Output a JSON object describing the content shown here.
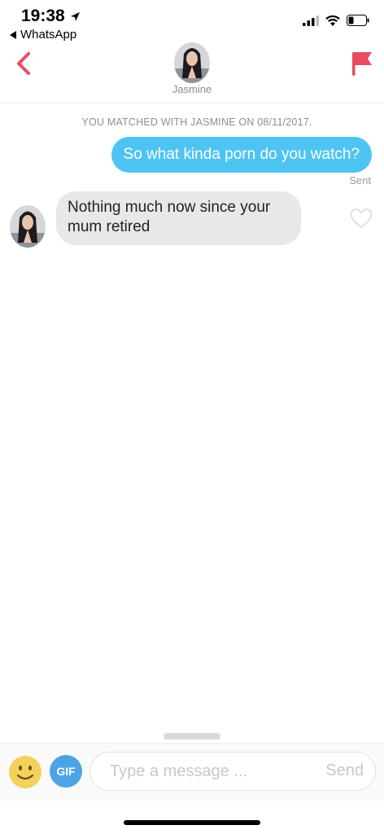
{
  "status_bar": {
    "time": "19:38",
    "back_app": "WhatsApp",
    "icons": [
      "location-arrow-icon",
      "signal-icon",
      "wifi-icon",
      "battery-icon"
    ]
  },
  "header": {
    "name": "Jasmine",
    "back_icon": "chevron-left-icon",
    "report_icon": "flag-icon",
    "accent_color": "#e94c61"
  },
  "chat": {
    "match_note": "YOU MATCHED WITH JASMINE ON 08/11/2017.",
    "messages": [
      {
        "from": "me",
        "text": "So what kinda porn do you watch?",
        "status": "Sent",
        "color": "#4ec4f3"
      },
      {
        "from": "Jasmine",
        "text": "Nothing much now since your mum retired",
        "color": "#e8e8ea"
      }
    ]
  },
  "composer": {
    "emoji_icon": "smiley-icon",
    "gif_label": "GIF",
    "placeholder": "Type a message ...",
    "value": "",
    "send_label": "Send"
  }
}
